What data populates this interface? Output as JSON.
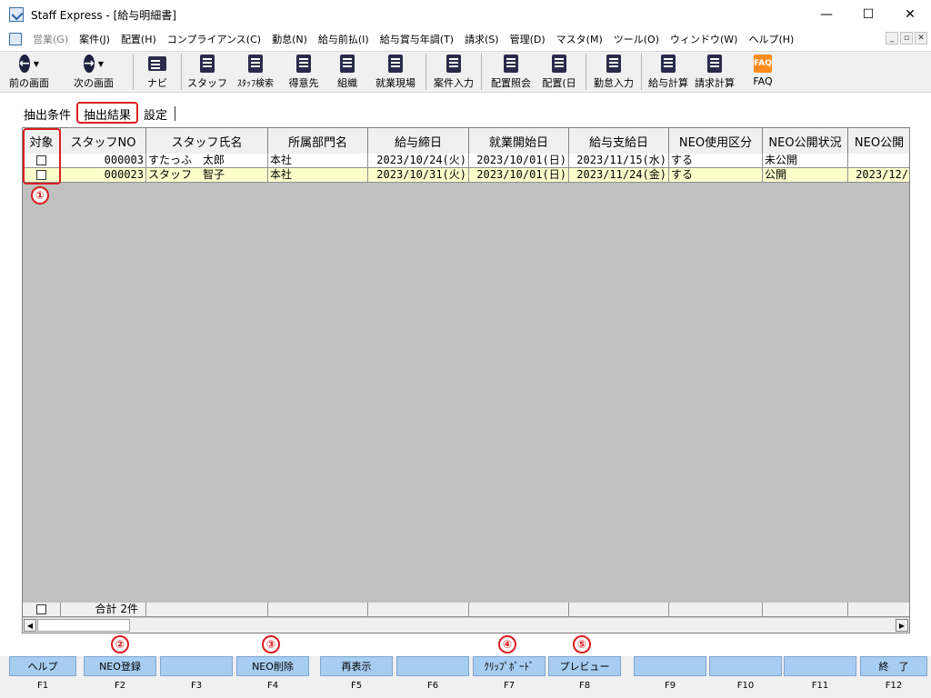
{
  "window": {
    "title": "Staff Express - [給与明細書]",
    "controls": {
      "minimize": "—",
      "maximize": "☐",
      "close": "✕"
    }
  },
  "menu": {
    "items": [
      {
        "label": "営業(G)",
        "disabled": true
      },
      {
        "label": "案件(J)"
      },
      {
        "label": "配置(H)"
      },
      {
        "label": "コンプライアンス(C)"
      },
      {
        "label": "勤怠(N)"
      },
      {
        "label": "給与前払(I)"
      },
      {
        "label": "給与賞与年調(T)"
      },
      {
        "label": "請求(S)"
      },
      {
        "label": "管理(D)"
      },
      {
        "label": "マスタ(M)"
      },
      {
        "label": "ツール(O)"
      },
      {
        "label": "ウィンドウ(W)"
      },
      {
        "label": "ヘルプ(H)"
      }
    ],
    "mdi_controls": {
      "minimize": "_",
      "restore": "▫",
      "close": "✕"
    }
  },
  "toolbar": {
    "items": [
      {
        "label": "前の画面",
        "icon": "arrow-left-circle-icon"
      },
      {
        "label": "次の画面",
        "icon": "arrow-right-circle-icon"
      },
      {
        "label": "ナビ",
        "icon": "navi-icon"
      },
      {
        "label": "スタッフ",
        "icon": "staff-icon"
      },
      {
        "label": "ｽﾀｯﾌ検索",
        "icon": "staff-search-icon"
      },
      {
        "label": "得意先",
        "icon": "client-icon"
      },
      {
        "label": "組織",
        "icon": "organization-icon"
      },
      {
        "label": "就業現場",
        "icon": "worksite-icon"
      },
      {
        "label": "案件入力",
        "icon": "case-entry-icon"
      },
      {
        "label": "配置照会",
        "icon": "assignment-inquiry-icon"
      },
      {
        "label": "配置(日",
        "icon": "assignment-daily-icon"
      },
      {
        "label": "勤怠入力",
        "icon": "attendance-entry-icon"
      },
      {
        "label": "給与計算",
        "icon": "payroll-calc-icon"
      },
      {
        "label": "請求計算",
        "icon": "billing-calc-icon"
      },
      {
        "label": "FAQ",
        "icon": "faq-icon",
        "icon_text": "FAQ"
      }
    ]
  },
  "tabs": [
    {
      "label": "抽出条件"
    },
    {
      "label": "抽出結果",
      "active": true
    },
    {
      "label": "設定"
    }
  ],
  "grid": {
    "columns": [
      "対象",
      "スタッフNO",
      "スタッフ氏名",
      "所属部門名",
      "給与締日",
      "就業開始日",
      "給与支給日",
      "NEO使用区分",
      "NEO公開状況",
      "NEO公開"
    ],
    "rows": [
      {
        "staff_no": "000003",
        "name": "すたっふ　太郎",
        "dept": "本社",
        "closing": "2023/10/24(火)",
        "start": "2023/10/01(日)",
        "pay": "2023/11/15(水)",
        "neo_use": "する",
        "neo_status": "未公開",
        "neo_date": ""
      },
      {
        "staff_no": "000023",
        "name": "スタッフ　智子",
        "dept": "本社",
        "closing": "2023/10/31(火)",
        "start": "2023/10/01(日)",
        "pay": "2023/11/24(金)",
        "neo_use": "する",
        "neo_status": "公開",
        "neo_date": "2023/12/"
      }
    ],
    "summary": "合計 2件",
    "scroll_left": "◀",
    "scroll_right": "▶"
  },
  "callouts": [
    "①",
    "②",
    "③",
    "④",
    "⑤"
  ],
  "fkeys": [
    {
      "label": "ヘルプ",
      "key": "F1"
    },
    {
      "label": "NEO登録",
      "key": "F2"
    },
    {
      "label": "",
      "key": "F3"
    },
    {
      "label": "NEO削除",
      "key": "F4"
    },
    {
      "label": "再表示",
      "key": "F5"
    },
    {
      "label": "",
      "key": "F6"
    },
    {
      "label": "ｸﾘｯﾌﾟﾎﾞｰﾄﾞ",
      "key": "F7"
    },
    {
      "label": "プレビュー",
      "key": "F8"
    },
    {
      "label": "",
      "key": "F9"
    },
    {
      "label": "",
      "key": "F10"
    },
    {
      "label": "",
      "key": "F11"
    },
    {
      "label": "終　了",
      "key": "F12"
    }
  ]
}
